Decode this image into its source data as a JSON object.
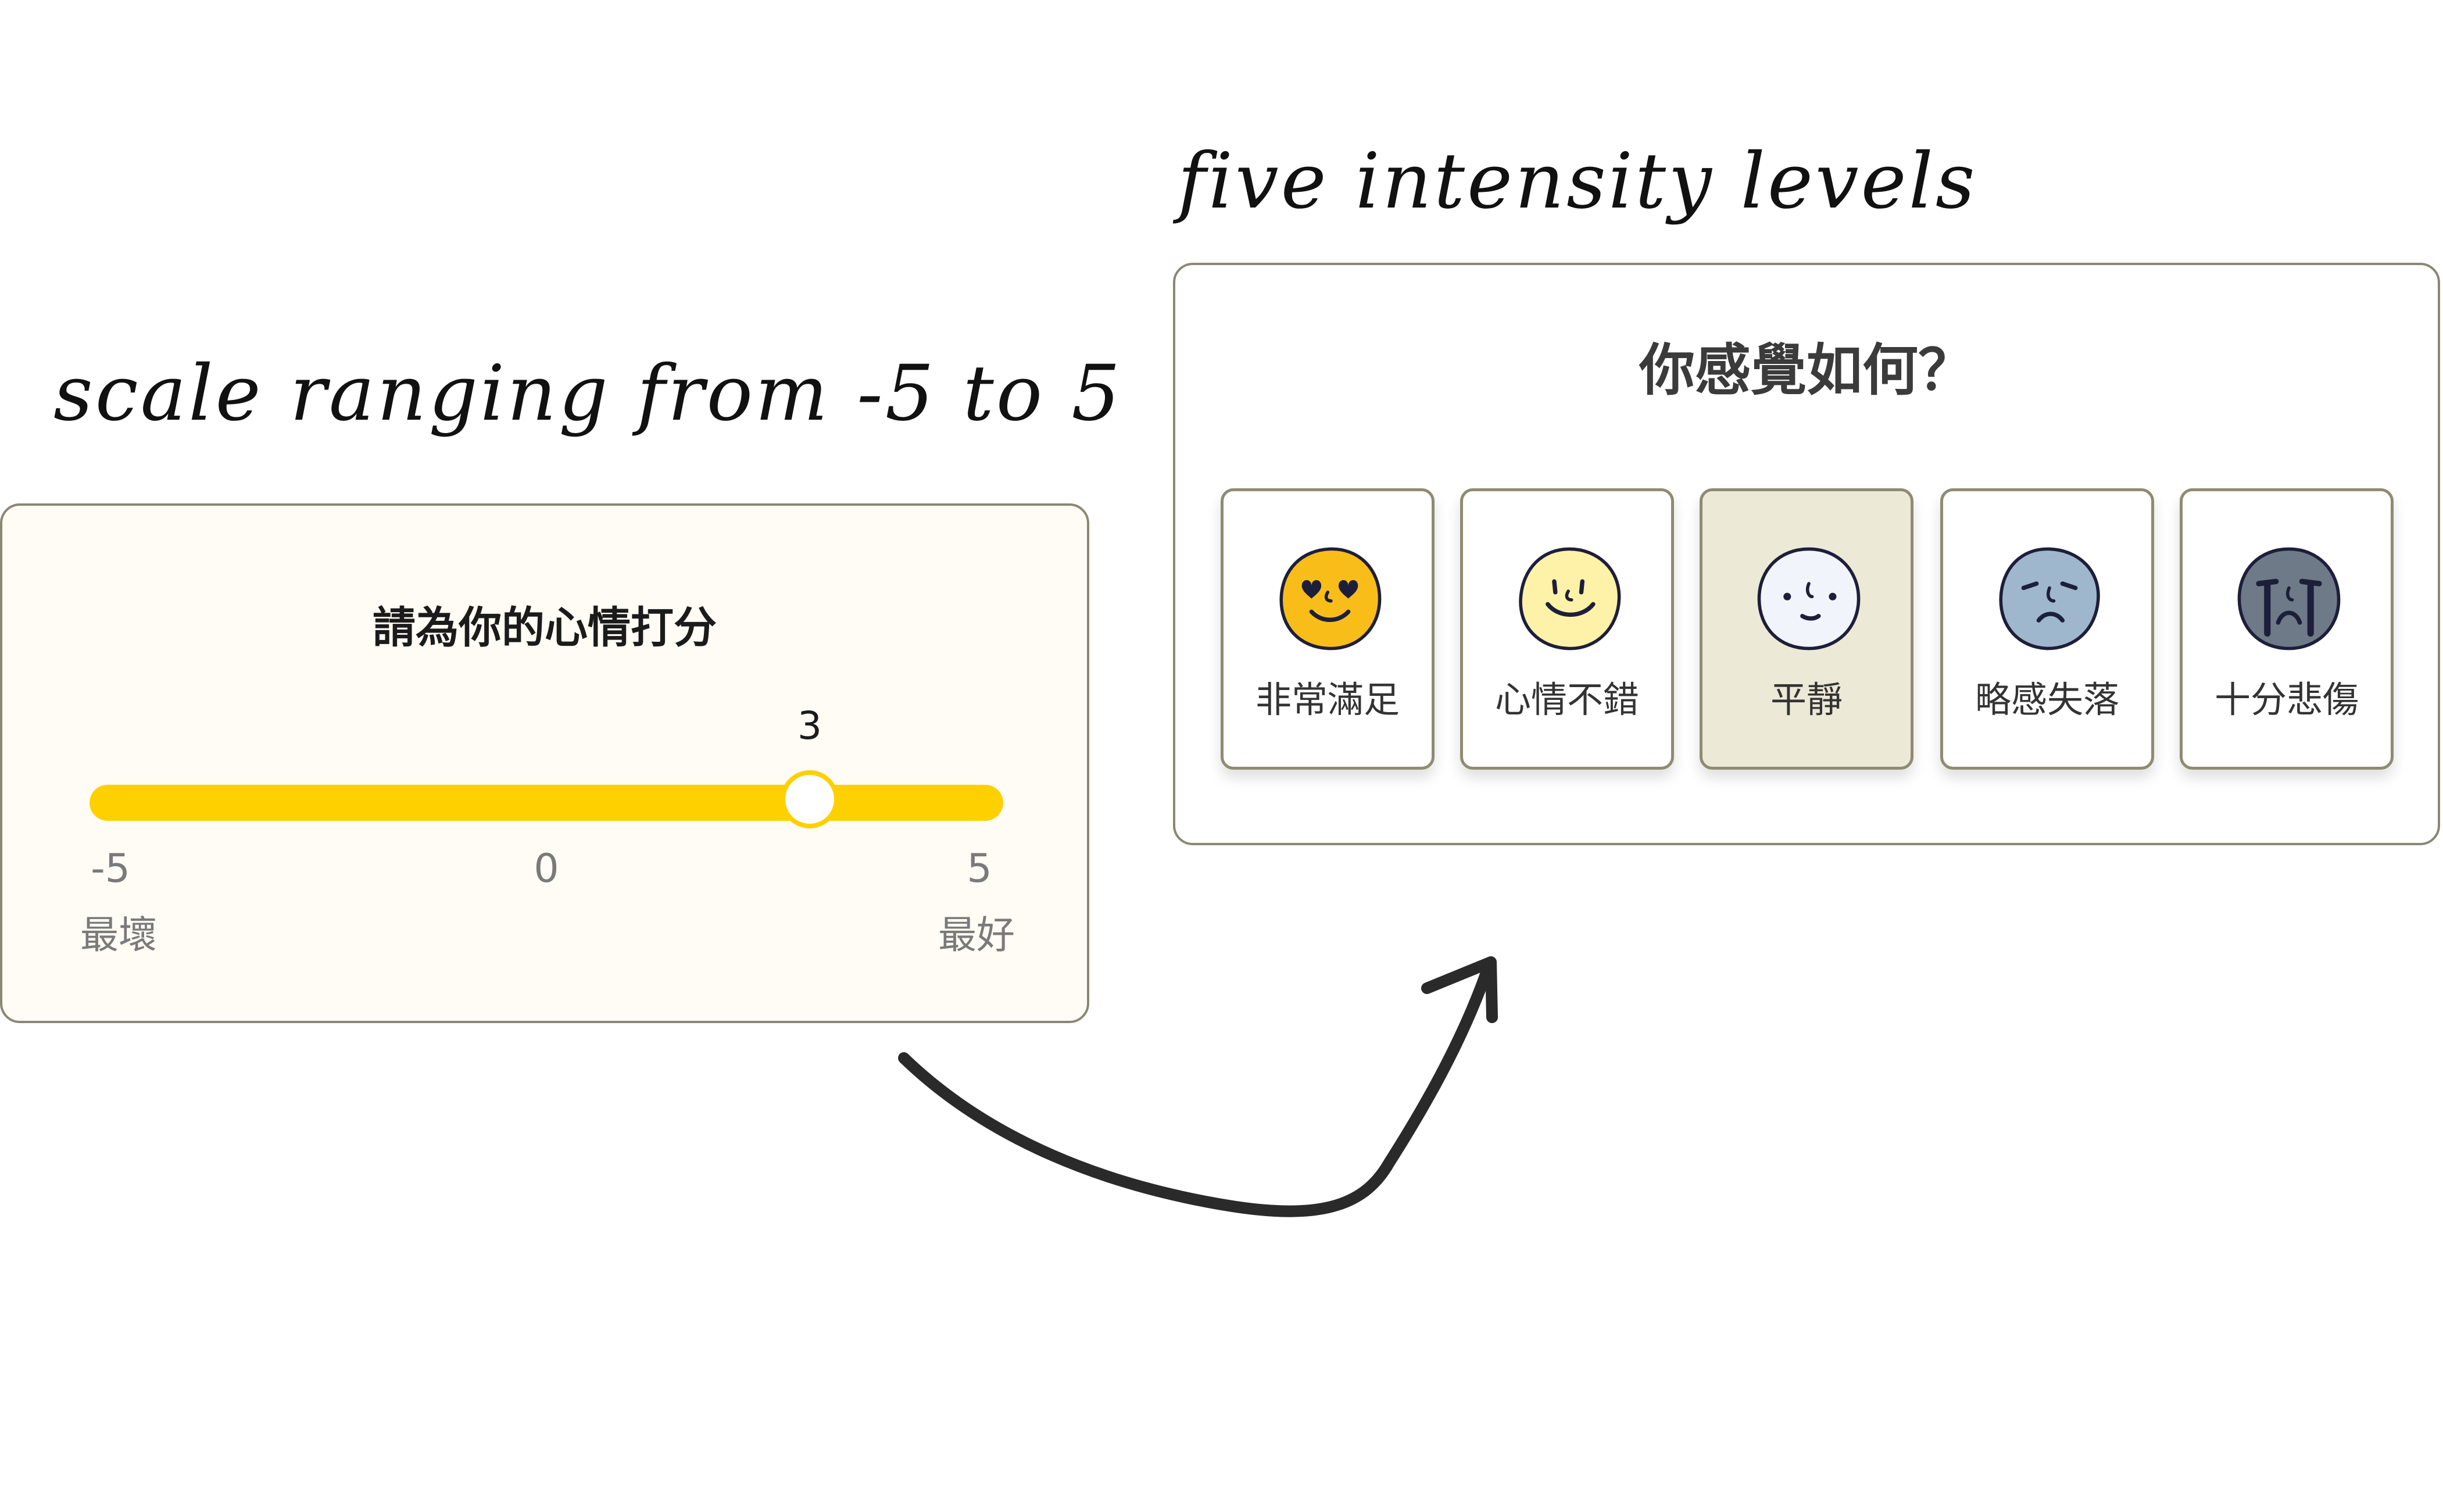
{
  "annotations": {
    "left": "scale ranging from -5 to 5",
    "right": "five intensity levels"
  },
  "slider": {
    "title": "請為你的心情打分",
    "min": -5,
    "max": 5,
    "value": 3,
    "value_label": "3",
    "ticks": [
      {
        "num": "-5",
        "label": "最壞"
      },
      {
        "num": "0",
        "label": ""
      },
      {
        "num": "5",
        "label": "最好"
      }
    ],
    "accent_color": "#ffd000"
  },
  "mood": {
    "title": "你感覺如何？",
    "selected_index": 2,
    "options": [
      {
        "label": "非常滿足",
        "icon": "heart-eyes-face-icon",
        "color": "#f9bd1a"
      },
      {
        "label": "心情不錯",
        "icon": "smiling-face-icon",
        "color": "#fef2a8"
      },
      {
        "label": "平靜",
        "icon": "neutral-face-icon",
        "color": "#f1f4fb"
      },
      {
        "label": "略感失落",
        "icon": "sad-face-icon",
        "color": "#9fb7cd"
      },
      {
        "label": "十分悲傷",
        "icon": "crying-face-icon",
        "color": "#6e7a88"
      }
    ]
  }
}
